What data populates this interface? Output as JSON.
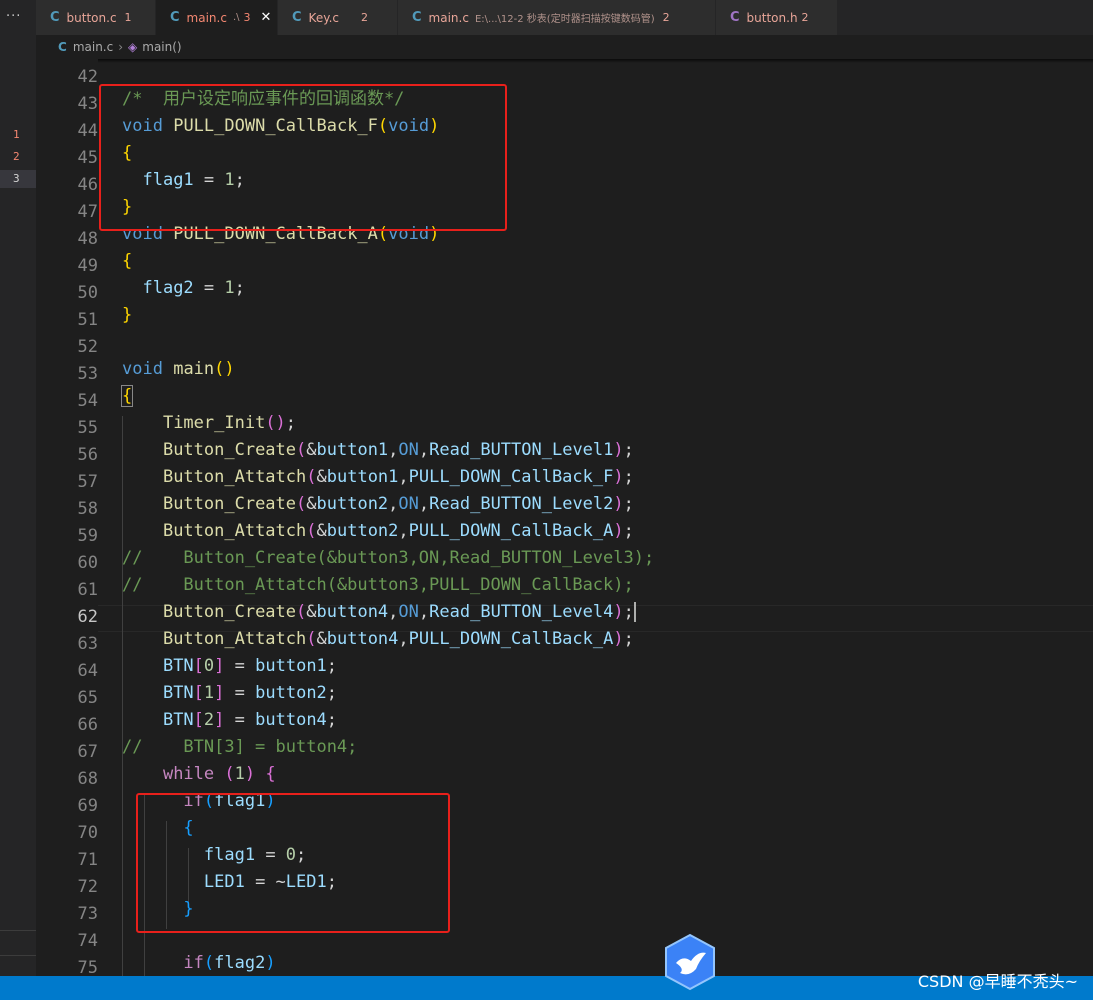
{
  "tabs": [
    {
      "name": "button.c",
      "badge": "1",
      "icon": "c-file-icon",
      "active": false
    },
    {
      "name": "main.c",
      "path": ".\\",
      "badge": "3",
      "icon": "c-file-icon",
      "active": true
    },
    {
      "name": "Key.c",
      "badge": "2",
      "icon": "c-file-icon",
      "active": false
    },
    {
      "name": "main.c",
      "path": "E:\\...\\12-2 秒表(定时器扫描按键数码管)",
      "badge": "2",
      "icon": "c-file-icon",
      "active": false
    },
    {
      "name": "button.h",
      "badge": "2",
      "icon": "h-file-icon",
      "active": false
    }
  ],
  "activity": {
    "more": "···",
    "problem_markers": [
      "1",
      "2",
      "3"
    ]
  },
  "breadcrumb": {
    "file": "main.c",
    "symbol": "main()"
  },
  "editor": {
    "line_numbers": [
      "42",
      "43",
      "44",
      "45",
      "46",
      "47",
      "48",
      "49",
      "50",
      "51",
      "52",
      "53",
      "54",
      "55",
      "56",
      "57",
      "58",
      "59",
      "60",
      "61",
      "62",
      "63",
      "64",
      "65",
      "66",
      "67",
      "68",
      "69",
      "70",
      "71",
      "72",
      "73",
      "74",
      "75"
    ],
    "current_line": "62",
    "code": {
      "l43_comment": "/*  用户设定响应事件的回调函数*/",
      "l44_type": "void",
      "l44_fn": "PULL_DOWN_CallBack_F",
      "l44_param": "void",
      "l46_var": "flag1",
      "l46_val": "1",
      "l48_type": "void",
      "l48_fn": "PULL_DOWN_CallBack_A",
      "l48_param": "void",
      "l50_var": "flag2",
      "l50_val": "1",
      "l53_type": "void",
      "l53_fn": "main",
      "l55_fn": "Timer_Init",
      "l56_fn": "Button_Create",
      "l56_a1": "button1",
      "l56_a2": "ON",
      "l56_a3": "Read_BUTTON_Level1",
      "l57_fn": "Button_Attatch",
      "l57_a1": "button1",
      "l57_a2": "PULL_DOWN_CallBack_F",
      "l58_fn": "Button_Create",
      "l58_a1": "button2",
      "l58_a2": "ON",
      "l58_a3": "Read_BUTTON_Level2",
      "l59_fn": "Button_Attatch",
      "l59_a1": "button2",
      "l59_a2": "PULL_DOWN_CallBack_A",
      "l60_comment": "//    Button_Create(&button3,ON,Read_BUTTON_Level3);",
      "l61_comment": "//    Button_Attatch(&button3,PULL_DOWN_CallBack);",
      "l62_fn": "Button_Create",
      "l62_a1": "button4",
      "l62_a2": "ON",
      "l62_a3": "Read_BUTTON_Level4",
      "l63_fn": "Button_Attatch",
      "l63_a1": "button4",
      "l63_a2": "PULL_DOWN_CallBack_A",
      "l64_arr": "BTN",
      "l64_idx": "0",
      "l64_val": "button1",
      "l65_arr": "BTN",
      "l65_idx": "1",
      "l65_val": "button2",
      "l66_arr": "BTN",
      "l66_idx": "2",
      "l66_val": "button4",
      "l67_comment": "//    BTN[3] = button4;",
      "l68_kw": "while",
      "l68_cond": "1",
      "l69_kw": "if",
      "l69_cond": "flag1",
      "l71_var": "flag1",
      "l71_val": "0",
      "l72_lhs": "LED1",
      "l72_rhs": "LED1",
      "l75_kw": "if",
      "l75_cond": "flag2"
    }
  },
  "watermark": "CSDN @早睡不秃头~",
  "colors": {
    "status_bar": "#007acc",
    "highlight_box": "#e8201b",
    "error_badge": "#f48771"
  }
}
